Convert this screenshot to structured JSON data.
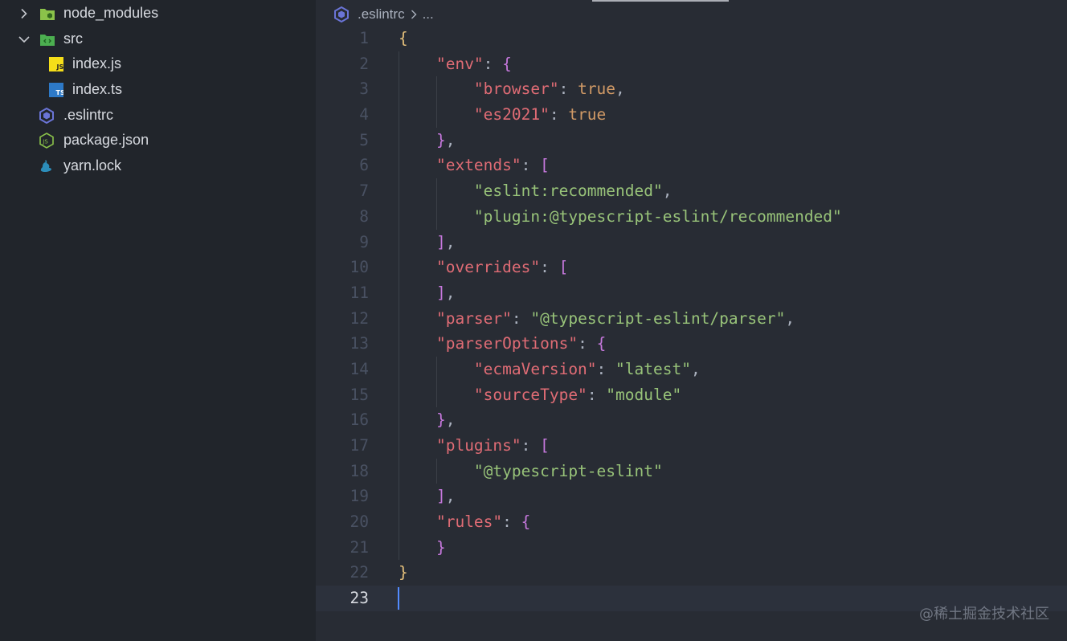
{
  "explorer": {
    "items": [
      {
        "label": "node_modules",
        "type": "folder",
        "expanded": false,
        "icon": "folder-node-icon"
      },
      {
        "label": "src",
        "type": "folder",
        "expanded": true,
        "icon": "folder-src-icon"
      },
      {
        "label": "index.js",
        "type": "file",
        "icon": "javascript-file-icon"
      },
      {
        "label": "index.ts",
        "type": "file",
        "icon": "typescript-file-icon"
      },
      {
        "label": ".eslintrc",
        "type": "file",
        "icon": "eslint-file-icon"
      },
      {
        "label": "package.json",
        "type": "file",
        "icon": "nodejs-file-icon"
      },
      {
        "label": "yarn.lock",
        "type": "file",
        "icon": "yarn-file-icon"
      }
    ]
  },
  "editor": {
    "breadcrumb": {
      "file": ".eslintrc",
      "rest": "..."
    },
    "current_line": 23,
    "lines": [
      [
        [
          "{",
          "brace0"
        ]
      ],
      [
        [
          "    ",
          ""
        ],
        [
          "\"env\"",
          "key"
        ],
        [
          ": ",
          "punc"
        ],
        [
          "{",
          "brace1"
        ]
      ],
      [
        [
          "        ",
          ""
        ],
        [
          "\"browser\"",
          "key"
        ],
        [
          ": ",
          "punc"
        ],
        [
          "true",
          "bool"
        ],
        [
          ",",
          "punc"
        ]
      ],
      [
        [
          "        ",
          ""
        ],
        [
          "\"es2021\"",
          "key"
        ],
        [
          ": ",
          "punc"
        ],
        [
          "true",
          "bool"
        ]
      ],
      [
        [
          "    ",
          ""
        ],
        [
          "}",
          "brace1"
        ],
        [
          ",",
          "punc"
        ]
      ],
      [
        [
          "    ",
          ""
        ],
        [
          "\"extends\"",
          "key"
        ],
        [
          ": ",
          "punc"
        ],
        [
          "[",
          "brace1"
        ]
      ],
      [
        [
          "        ",
          ""
        ],
        [
          "\"eslint:recommended\"",
          "str"
        ],
        [
          ",",
          "punc"
        ]
      ],
      [
        [
          "        ",
          ""
        ],
        [
          "\"plugin:@typescript-eslint/recommended\"",
          "str"
        ]
      ],
      [
        [
          "    ",
          ""
        ],
        [
          "]",
          "brace1"
        ],
        [
          ",",
          "punc"
        ]
      ],
      [
        [
          "    ",
          ""
        ],
        [
          "\"overrides\"",
          "key"
        ],
        [
          ": ",
          "punc"
        ],
        [
          "[",
          "brace1"
        ]
      ],
      [
        [
          "    ",
          ""
        ],
        [
          "]",
          "brace1"
        ],
        [
          ",",
          "punc"
        ]
      ],
      [
        [
          "    ",
          ""
        ],
        [
          "\"parser\"",
          "key"
        ],
        [
          ": ",
          "punc"
        ],
        [
          "\"@typescript-eslint/parser\"",
          "str"
        ],
        [
          ",",
          "punc"
        ]
      ],
      [
        [
          "    ",
          ""
        ],
        [
          "\"parserOptions\"",
          "key"
        ],
        [
          ": ",
          "punc"
        ],
        [
          "{",
          "brace1"
        ]
      ],
      [
        [
          "        ",
          ""
        ],
        [
          "\"ecmaVersion\"",
          "key"
        ],
        [
          ": ",
          "punc"
        ],
        [
          "\"latest\"",
          "str"
        ],
        [
          ",",
          "punc"
        ]
      ],
      [
        [
          "        ",
          ""
        ],
        [
          "\"sourceType\"",
          "key"
        ],
        [
          ": ",
          "punc"
        ],
        [
          "\"module\"",
          "str"
        ]
      ],
      [
        [
          "    ",
          ""
        ],
        [
          "}",
          "brace1"
        ],
        [
          ",",
          "punc"
        ]
      ],
      [
        [
          "    ",
          ""
        ],
        [
          "\"plugins\"",
          "key"
        ],
        [
          ": ",
          "punc"
        ],
        [
          "[",
          "brace1"
        ]
      ],
      [
        [
          "        ",
          ""
        ],
        [
          "\"@typescript-eslint\"",
          "str"
        ]
      ],
      [
        [
          "    ",
          ""
        ],
        [
          "]",
          "brace1"
        ],
        [
          ",",
          "punc"
        ]
      ],
      [
        [
          "    ",
          ""
        ],
        [
          "\"rules\"",
          "key"
        ],
        [
          ": ",
          "punc"
        ],
        [
          "{",
          "brace1"
        ]
      ],
      [
        [
          "    ",
          ""
        ],
        [
          "}",
          "brace1"
        ]
      ],
      [
        [
          "}",
          "brace0"
        ]
      ],
      [
        [
          "",
          ""
        ]
      ]
    ]
  },
  "watermark": "@稀土掘金技术社区",
  "colors": {
    "sidebar_bg": "#21252b",
    "editor_bg": "#282c34",
    "key": "#e06c75",
    "string": "#98c379",
    "boolean": "#d19a66",
    "brace_outer": "#e5c07b",
    "brace_inner": "#c678dd",
    "cursor": "#528bff"
  }
}
